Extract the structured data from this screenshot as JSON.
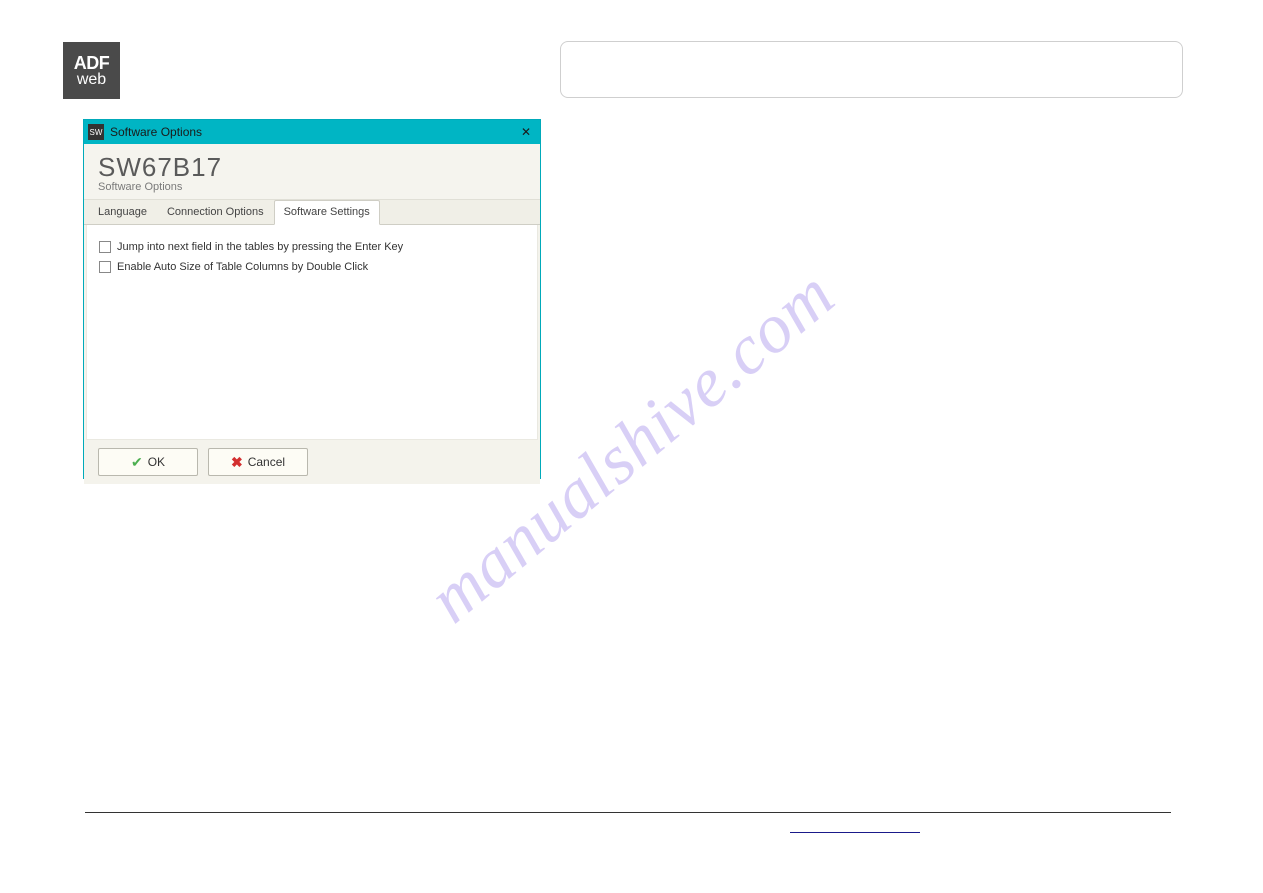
{
  "logo": {
    "line1": "ADF",
    "line2": "web"
  },
  "dialog": {
    "titlebar": "Software Options",
    "heading": "SW67B17",
    "subheading": "Software Options",
    "tabs": [
      "Language",
      "Connection Options",
      "Software Settings"
    ],
    "active_tab_index": 2,
    "checkboxes": [
      {
        "label": "Jump into next field in the tables by pressing the Enter Key",
        "checked": false
      },
      {
        "label": "Enable Auto Size of Table Columns by Double Click",
        "checked": false
      }
    ],
    "ok_label": "OK",
    "cancel_label": "Cancel"
  },
  "watermark": "manualshive.com"
}
